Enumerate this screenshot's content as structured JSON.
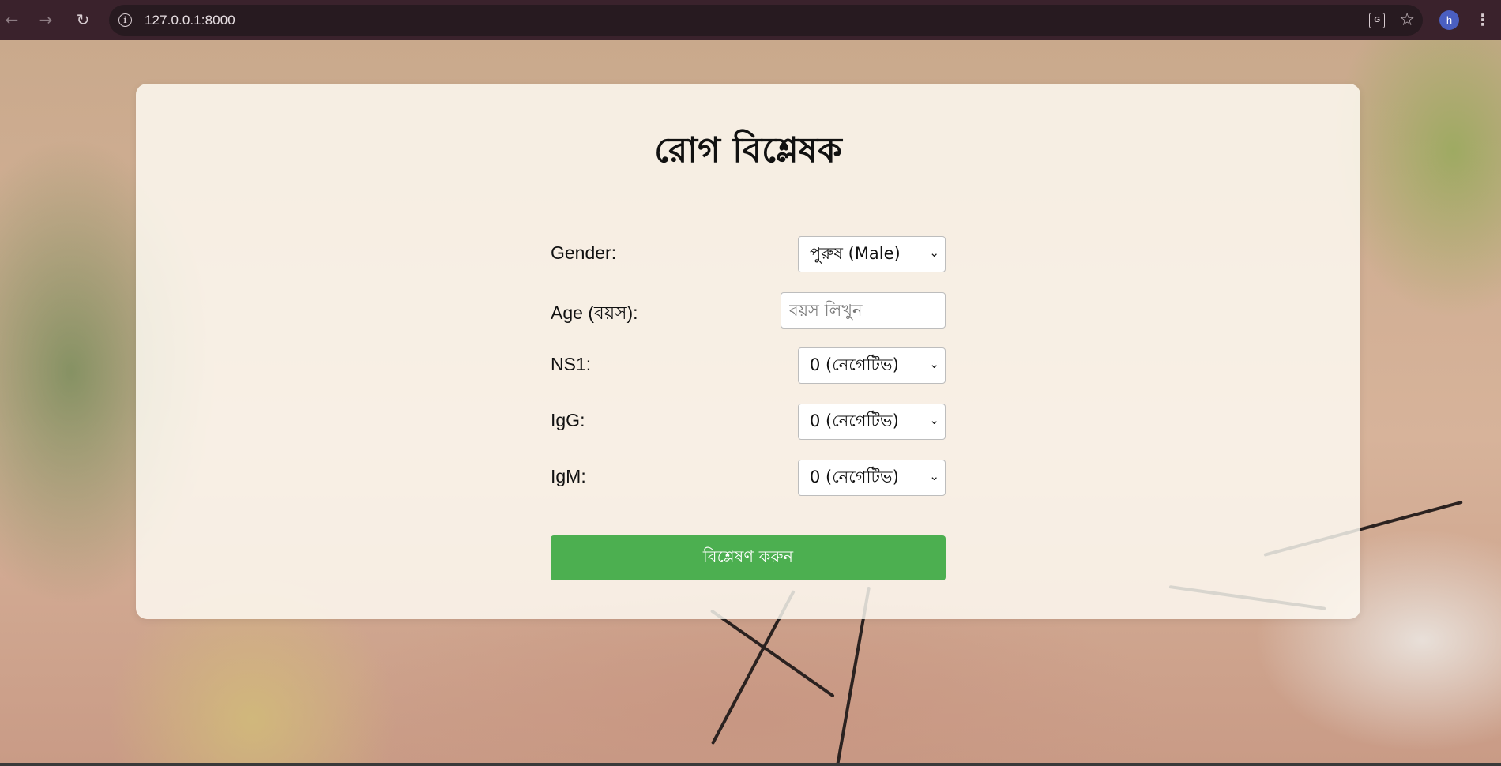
{
  "browser": {
    "url": "127.0.0.1:8000",
    "profile_initial": "h",
    "back_icon": "←",
    "forward_icon": "→",
    "reload_icon": "↻",
    "info_glyph": "i",
    "translate_glyph": "G",
    "star_glyph": "☆",
    "menu_glyph": "⋮"
  },
  "page": {
    "title": "রোগ বিশ্লেষক",
    "fields": {
      "gender": {
        "label": "Gender:",
        "selected": "পুরুষ (Male)"
      },
      "age": {
        "label": "Age (বয়স):",
        "placeholder": "বয়স লিখুন",
        "value": ""
      },
      "ns1": {
        "label": "NS1:",
        "selected": "0 (নেগেটিভ)"
      },
      "igg": {
        "label": "IgG:",
        "selected": "0 (নেগেটিভ)"
      },
      "igm": {
        "label": "IgM:",
        "selected": "0 (নেগেটিভ)"
      }
    },
    "submit_label": "বিশ্লেষণ করুন",
    "chevron": "⌄"
  },
  "colors": {
    "browser_bar": "#3a222c",
    "omnibox": "#271a20",
    "submit_button": "#4caf50",
    "avatar": "#4a5fc1"
  }
}
